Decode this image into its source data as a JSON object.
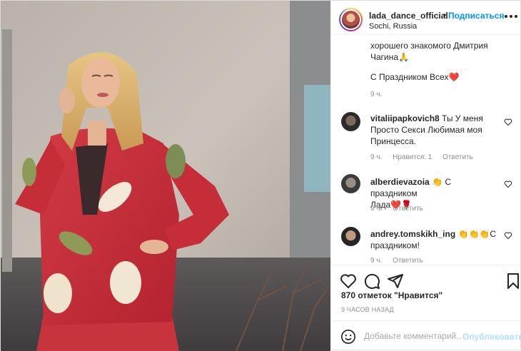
{
  "header": {
    "username": "lada_dance_official",
    "dot": "•",
    "follow_label": "Подписаться",
    "location": "Sochi, Russia"
  },
  "caption": {
    "lines": [
      "хорошего знакомого Дмитрия",
      "Чагина🙏",
      "С Праздником Всех❤️"
    ],
    "time": "9 ч."
  },
  "comments": [
    {
      "username": "vitaliipapkovich8",
      "text_first": "Ты У меня",
      "text_rest": [
        "Просто Секси Любимая моя",
        "Принцесса."
      ],
      "time": "9 ч.",
      "likes": "Нравится: 1",
      "reply": "Ответить"
    },
    {
      "username": "alberdievazoia",
      "text_first": "👏 С праздником",
      "text_rest": [
        "Лада❤️🌹"
      ],
      "time": "9 ч.",
      "reply": "Ответить"
    },
    {
      "username": "andrey.tomskikh_ing",
      "text_first": "👏👏👏С",
      "text_rest": [
        "праздником!"
      ],
      "time": "9 ч.",
      "reply": "Ответить"
    }
  ],
  "likes_text": "870 отметок \"Нравится\"",
  "time_ago": "9 ЧАСОВ НАЗАД",
  "add_comment": {
    "placeholder": "Добавьте комментарий...",
    "publish_label": "Опубликовать"
  },
  "colors": {
    "link_blue": "#0095f6",
    "publish_disabled": "#b2dffc",
    "secondary_text": "#8e8e8e"
  },
  "icons": [
    "more-icon",
    "heart-icon",
    "comment-icon",
    "share-icon",
    "bookmark-icon",
    "emoji-icon"
  ]
}
